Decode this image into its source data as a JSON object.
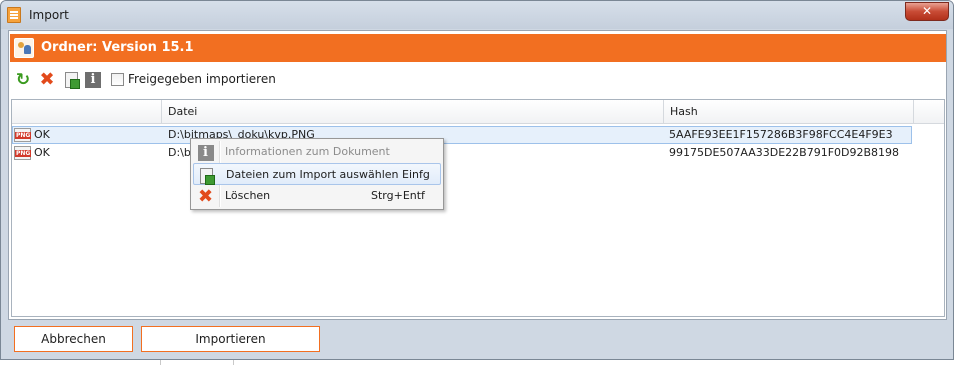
{
  "window": {
    "title": "Import",
    "close_label": "✕"
  },
  "header": {
    "title": "Ordner: Version 15.1"
  },
  "toolbar": {
    "checkbox_label": "Freigegeben importieren",
    "checkbox_checked": false
  },
  "grid": {
    "columns": [
      "",
      "Datei",
      "Hash"
    ],
    "rows": [
      {
        "status": "OK",
        "file": "D:\\bitmaps\\_doku\\kvp.PNG",
        "hash": "5AAFE93EE1F157286B3F98FCC4E4F9E3",
        "selected": true
      },
      {
        "status": "OK",
        "file": "D:\\b",
        "hash": "99175DE507AA33DE22B791F0D92B8198",
        "selected": false
      }
    ]
  },
  "context_menu": {
    "items": [
      {
        "label": "Informationen zum Dokument",
        "shortcut": "",
        "disabled": true
      },
      {
        "label": "Dateien zum Import auswählen Einfg",
        "shortcut": "",
        "disabled": false,
        "highlighted": true
      },
      {
        "label": "Löschen",
        "shortcut": "Strg+Entf",
        "disabled": false
      }
    ]
  },
  "footer": {
    "cancel_label": "Abbrechen",
    "import_label": "Importieren"
  },
  "colors": {
    "accent": "#f26f21",
    "frame": "#cfd8e3",
    "selection": "#e6f0fb"
  }
}
